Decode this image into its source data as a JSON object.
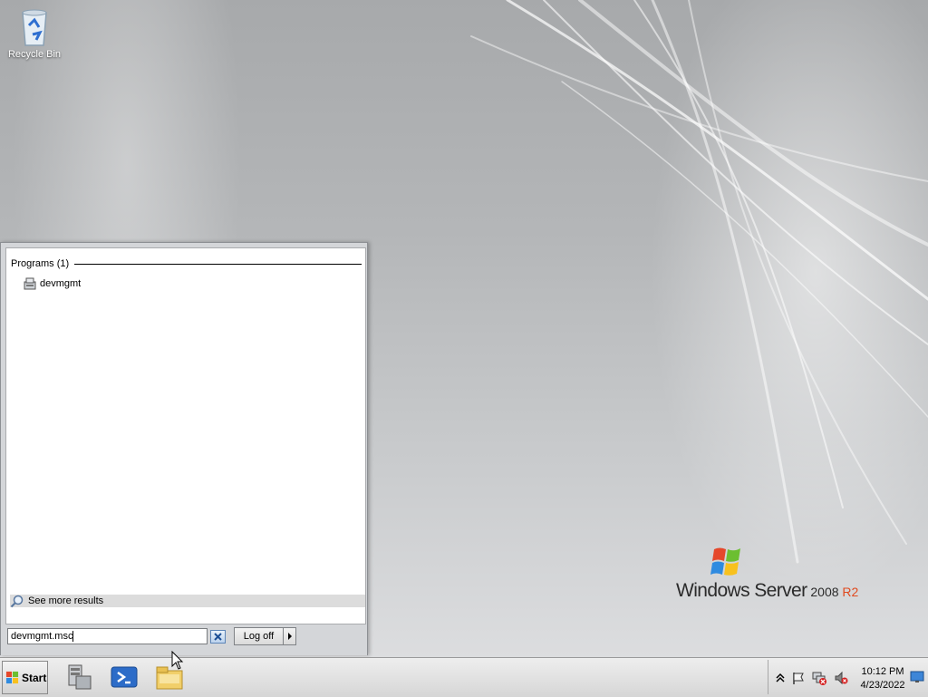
{
  "desktop": {
    "icons": [
      {
        "label": "Recycle Bin",
        "icon": "recycle-bin-icon"
      }
    ],
    "brand": {
      "text_main": "Windows Server",
      "text_version": " 2008",
      "text_r2": " R2"
    }
  },
  "start_menu": {
    "group_header": "Programs (1)",
    "results": [
      {
        "label": "devmgmt",
        "icon": "device-manager-icon"
      }
    ],
    "see_more": "See more results",
    "search": {
      "value": "devmgmt.msc"
    },
    "logoff_label": "Log off"
  },
  "taskbar": {
    "start_label": "Start",
    "pinned": [
      {
        "name": "server-manager-icon"
      },
      {
        "name": "powershell-icon"
      },
      {
        "name": "explorer-icon"
      }
    ],
    "tray": {
      "time": "10:12 PM",
      "date": "4/23/2022"
    }
  },
  "colors": {
    "desktop_bg": "#b4b6b8",
    "start_menu_bg": "#d4d6d9",
    "r2_accent": "#e04a1f"
  }
}
